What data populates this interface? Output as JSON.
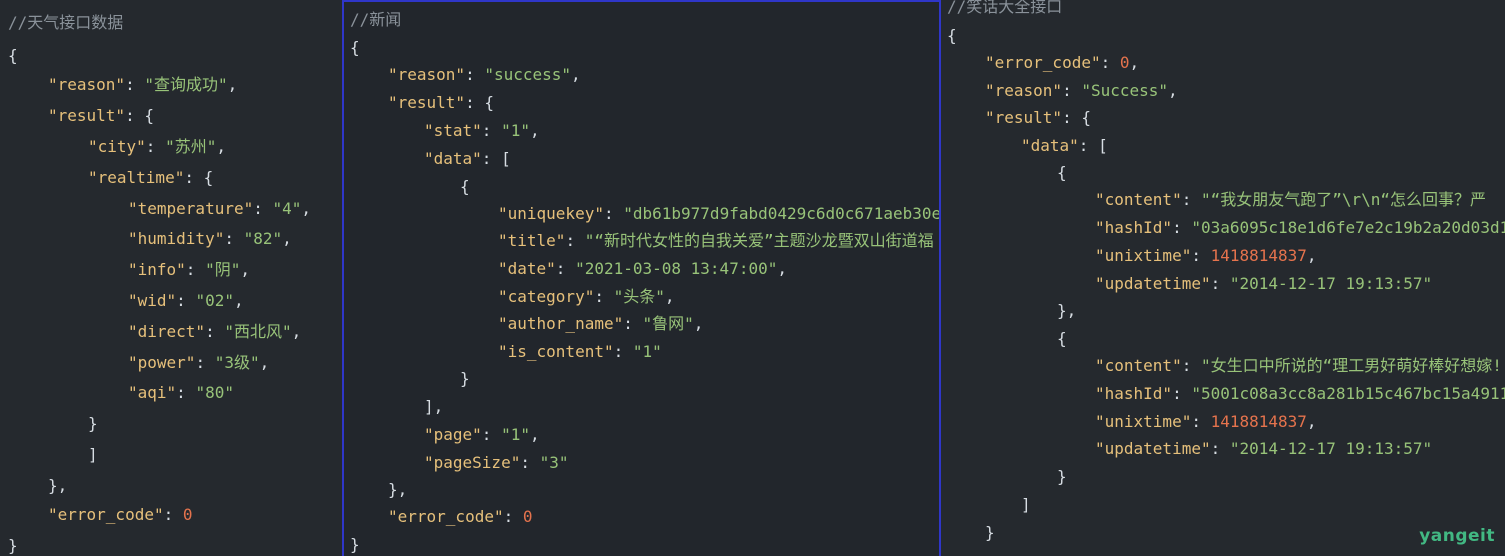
{
  "panel1": {
    "comment": "//天气接口数据",
    "reason_key": "\"reason\"",
    "reason_val": "\"查询成功\"",
    "result_key": "\"result\"",
    "city_key": "\"city\"",
    "city_val": "\"苏州\"",
    "realtime_key": "\"realtime\"",
    "temperature_key": "\"temperature\"",
    "temperature_val": "\"4\"",
    "humidity_key": "\"humidity\"",
    "humidity_val": "\"82\"",
    "info_key": "\"info\"",
    "info_val": "\"阴\"",
    "wid_key": "\"wid\"",
    "wid_val": "\"02\"",
    "direct_key": "\"direct\"",
    "direct_val": "\"西北风\"",
    "power_key": "\"power\"",
    "power_val": "\"3级\"",
    "aqi_key": "\"aqi\"",
    "aqi_val": "\"80\"",
    "error_code_key": "\"error_code\"",
    "error_code_val": "0"
  },
  "panel2": {
    "comment": "//新闻",
    "reason_key": "\"reason\"",
    "reason_val": "\"success\"",
    "result_key": "\"result\"",
    "stat_key": "\"stat\"",
    "stat_val": "\"1\"",
    "data_key": "\"data\"",
    "uniquekey_key": "\"uniquekey\"",
    "uniquekey_val": "\"db61b977d9fabd0429c6d0c671aeb30e\"",
    "title_key": "\"title\"",
    "title_val": "\"“新时代女性的自我关爱”主题沙龙暨双山街道福",
    "date_key": "\"date\"",
    "date_val": "\"2021-03-08 13:47:00\"",
    "category_key": "\"category\"",
    "category_val": "\"头条\"",
    "author_key": "\"author_name\"",
    "author_val": "\"鲁网\"",
    "is_content_key": "\"is_content\"",
    "is_content_val": "\"1\"",
    "page_key": "\"page\"",
    "page_val": "\"1\"",
    "pagesize_key": "\"pageSize\"",
    "pagesize_val": "\"3\"",
    "error_code_key": "\"error_code\"",
    "error_code_val": "0"
  },
  "panel3": {
    "comment": "//笑话大全接口",
    "error_code_key": "\"error_code\"",
    "error_code_val": "0",
    "reason_key": "\"reason\"",
    "reason_val": "\"Success\"",
    "result_key": "\"result\"",
    "data_key": "\"data\"",
    "content1_key": "\"content\"",
    "content1_val": "\"“我女朋友气跑了”\\r\\n“怎么回事？严",
    "hashid1_key": "\"hashId\"",
    "hashid1_val": "\"03a6095c18e1d6fe7e2c19b2a20d03d1\"",
    "unixtime1_key": "\"unixtime\"",
    "unixtime1_val": "1418814837",
    "updatetime1_key": "\"updatetime\"",
    "updatetime1_val": "\"2014-12-17 19:13:57\"",
    "content2_key": "\"content\"",
    "content2_val": "\"女生口中所说的“理工男好萌好棒好想嫁!",
    "hashid2_key": "\"hashId\"",
    "hashid2_val": "\"5001c08a3cc8a281b15c467bc15a4911\"",
    "unixtime2_key": "\"unixtime\"",
    "unixtime2_val": "1418814837",
    "updatetime2_key": "\"updatetime\"",
    "updatetime2_val": "\"2014-12-17 19:13:57\""
  },
  "watermark": "yangeit",
  "colors": {
    "key": "#e6c07b",
    "string": "#98c379",
    "number": "#e5734d",
    "comment": "#8a929a",
    "selected_border": "#2f36c9"
  }
}
